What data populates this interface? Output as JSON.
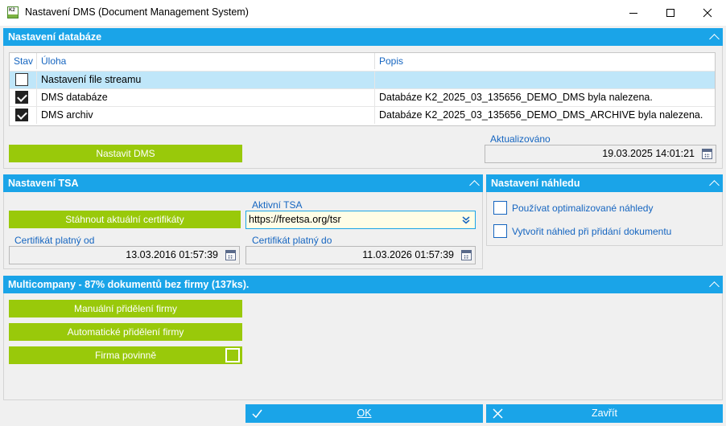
{
  "window": {
    "title": "Nastavení DMS (Document Management System)",
    "minimize": "—",
    "maximize": "☐",
    "close": "✕"
  },
  "database": {
    "header": "Nastavení databáze",
    "columns": [
      "Stav",
      "Úloha",
      "Popis"
    ],
    "rows": [
      {
        "checked": false,
        "task": "Nastavení file streamu",
        "description": ""
      },
      {
        "checked": true,
        "task": "DMS databáze",
        "description": "Databáze K2_2025_03_135656_DEMO_DMS byla nalezena."
      },
      {
        "checked": true,
        "task": "DMS archiv",
        "description": "Databáze K2_2025_03_135656_DEMO_DMS_ARCHIVE byla nalezena."
      }
    ],
    "setup_button": "Nastavit DMS",
    "updated_label": "Aktualizováno",
    "updated_value": "19.03.2025 14:01:21"
  },
  "tsa": {
    "header": "Nastavení TSA",
    "download_button": "Stáhnout aktuální certifikáty",
    "active_label": "Aktivní TSA",
    "active_value": "https://freetsa.org/tsr",
    "valid_from_label": "Certifikát platný od",
    "valid_from_value": "13.03.2016 01:57:39",
    "valid_to_label": "Certifikát platný do",
    "valid_to_value": "11.03.2026 01:57:39"
  },
  "preview": {
    "header": "Nastavení náhledu",
    "options": [
      {
        "label": "Používat optimalizované náhledy",
        "checked": false
      },
      {
        "label": "Vytvořit náhled při přidání dokumentu",
        "checked": false
      }
    ]
  },
  "multicompany": {
    "header": "Multicompany - 87% dokumentů bez firmy (137ks).",
    "manual_button": "Manuální přidělení firmy",
    "auto_button": "Automatické přidělení firmy",
    "required_label": "Firma povinně"
  },
  "footer": {
    "ok": "OK",
    "close": "Zavřít"
  },
  "colors": {
    "accent": "#1aa4e8",
    "green": "#99c90a",
    "label": "#1565c0"
  }
}
